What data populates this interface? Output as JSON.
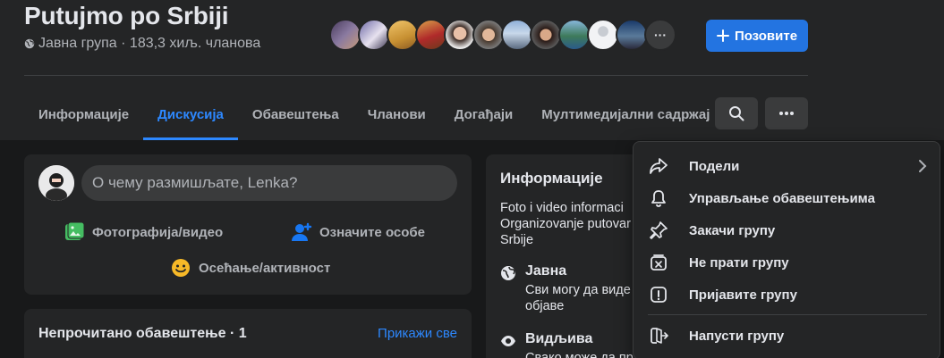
{
  "group": {
    "title": "Putujmo po Srbiji",
    "meta": "Јавна група · 183,3 хиљ. чланова"
  },
  "members_more": "···",
  "invite_label": "Позовите",
  "tabs": [
    {
      "label": "Информације"
    },
    {
      "label": "Дискусија"
    },
    {
      "label": "Обавештења"
    },
    {
      "label": "Чланови"
    },
    {
      "label": "Догађаји"
    },
    {
      "label": "Мултимедијални садржај"
    }
  ],
  "composer": {
    "placeholder": "О чему размишљате, Lenka?",
    "photo_label": "Фотографија/видео",
    "tag_label": "Означите особе",
    "feeling_label": "Осећање/активност"
  },
  "unread": {
    "title": "Непрочитано обавештење · 1",
    "link": "Прикажи све"
  },
  "info": {
    "title": "Информације",
    "desc": "Foto i video informaci Organizovanje putovar Srbije",
    "public_title": "Јавна",
    "public_desc": "Сви могу да виде објаве",
    "visible_title": "Видљива",
    "visible_desc": "Свако може да пр"
  },
  "menu": {
    "share": "Подели",
    "notifications": "Управљање обавештењима",
    "pin": "Закачи групу",
    "unfollow": "Не прати групу",
    "report": "Пријавите групу",
    "leave": "Напусти групу"
  },
  "colors": {
    "accent": "#2d88ff",
    "button": "#2374e1",
    "background": "#18191a",
    "surface": "#242526"
  }
}
